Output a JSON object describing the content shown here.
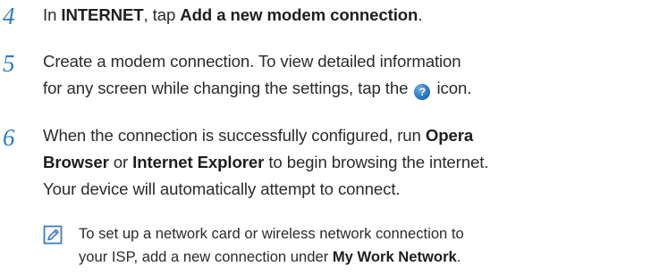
{
  "steps": [
    {
      "number": "4",
      "prefix": "In ",
      "bold1": "INTERNET",
      "middle": ", tap ",
      "bold2": "Add a new modem connection",
      "suffix": "."
    },
    {
      "number": "5",
      "line1": "Create a modem connection. To view detailed information",
      "line2_prefix": "for any screen while changing the settings, tap the ",
      "line2_suffix": " icon.",
      "icon_name": "help-icon",
      "icon_glyph": "?"
    },
    {
      "number": "6",
      "line1_prefix": "When the connection is successfully configured, run ",
      "line1_bold": "Opera",
      "line2_bold1": "Browser",
      "line2_middle": " or ",
      "line2_bold2": "Internet Explorer",
      "line2_suffix": " to begin browsing the internet.",
      "line3": "Your device will automatically attempt to connect."
    }
  ],
  "note": {
    "icon_name": "note-icon",
    "line1": "To set up a network card or wireless network connection to",
    "line2_prefix": "your ISP, add a new connection under ",
    "line2_bold": "My Work Network",
    "line2_suffix": "."
  },
  "colors": {
    "step_number": "#2c7bc2",
    "body_text": "#2b2b2b",
    "help_icon": "#2b78c4",
    "note_icon": "#3a7fc4"
  }
}
